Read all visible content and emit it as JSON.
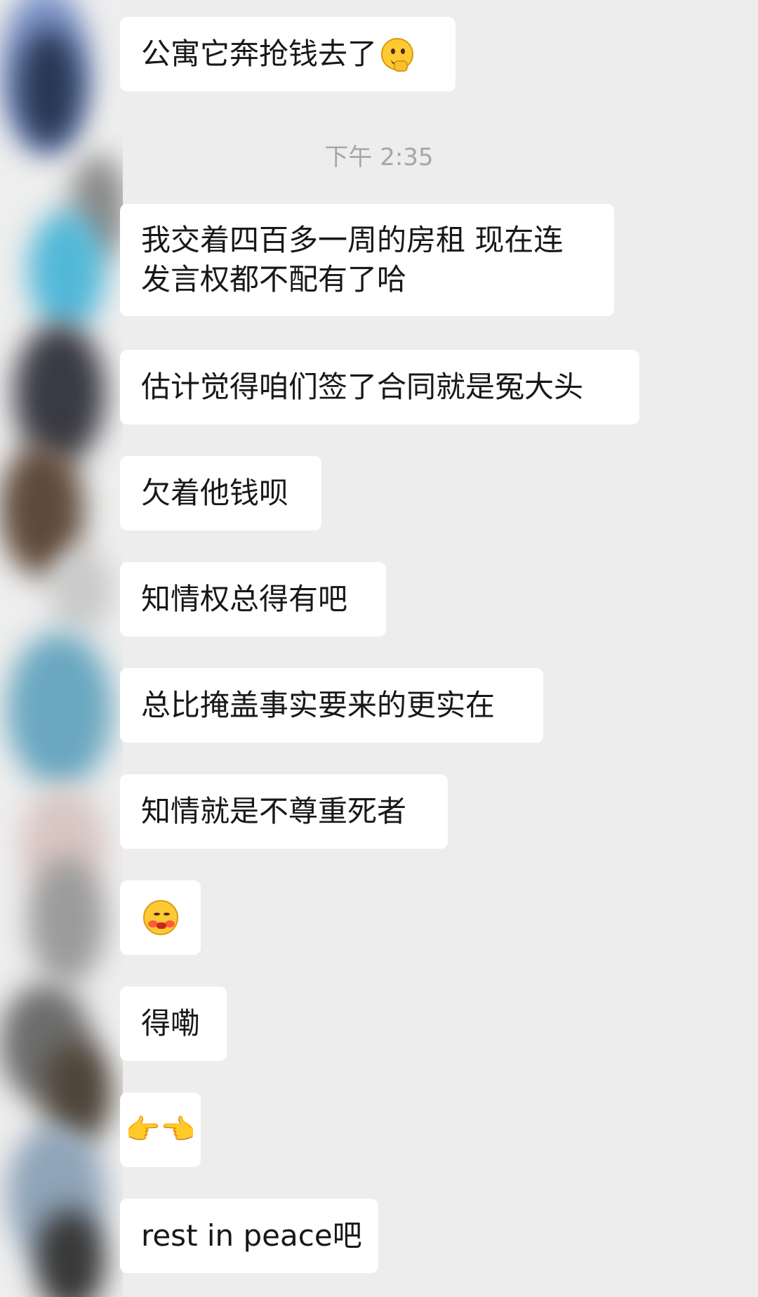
{
  "chat": {
    "timestamp": "下午 2:35",
    "messages": [
      {
        "text": "公寓它奔抢钱去了",
        "emoji": "thinking-face-icon"
      },
      {
        "lines": [
          "我交着四百多一周的房租 现在连",
          "发言权都不配有了哈"
        ]
      },
      {
        "text": "估计觉得咱们签了合同就是冤大头"
      },
      {
        "text": "欠着他钱呗"
      },
      {
        "text": "知情权总得有吧"
      },
      {
        "text": "总比掩盖事实要来的更实在"
      },
      {
        "text": "知情就是不尊重死者"
      },
      {
        "emoji": "blushing-face-icon"
      },
      {
        "text": "得嘞"
      },
      {
        "emoji": "pointing-hands-icon",
        "glyph": "👉👈"
      },
      {
        "text": "rest in peace吧"
      }
    ]
  },
  "colors": {
    "background": "#ededed",
    "bubble": "#ffffff",
    "text": "#181818",
    "timestamp": "#a6a6a6"
  }
}
